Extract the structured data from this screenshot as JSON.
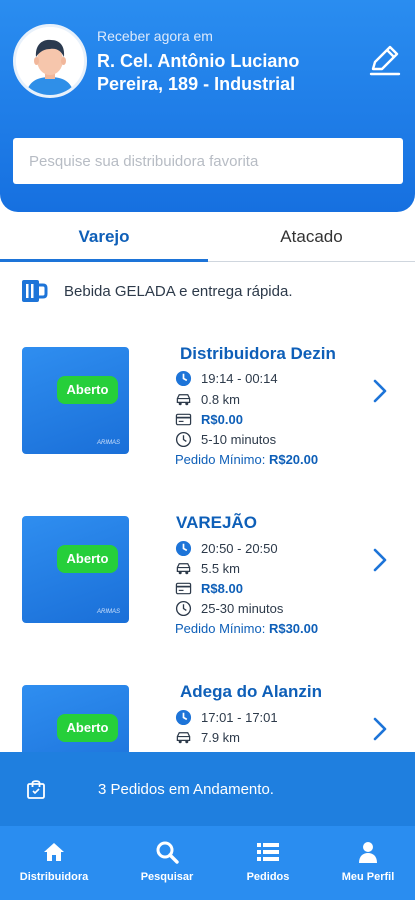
{
  "header": {
    "caption": "Receber agora em",
    "address_line1": "R. Cel. Antônio Luciano",
    "address_line2": "Pereira, 189 - Industrial",
    "search_placeholder": "Pesquise sua distribuidora favorita"
  },
  "tabs": [
    {
      "label": "Varejo",
      "active": true
    },
    {
      "label": "Atacado",
      "active": false
    }
  ],
  "banner": {
    "text": "Bebida GELADA e entrega rápida."
  },
  "stores": [
    {
      "name": "Distribuidora Dezin",
      "status": "Aberto",
      "hours": "19:14 - 00:14",
      "distance": "0.8 km",
      "fee": "R$0.00",
      "time": "5-10 minutos",
      "min_label": "Pedido Mínimo:",
      "min_value": "R$20.00"
    },
    {
      "name": "VAREJÃO",
      "status": "Aberto",
      "hours": "20:50 - 20:50",
      "distance": "5.5 km",
      "fee": "R$8.00",
      "time": "25-30 minutos",
      "min_label": "Pedido Mínimo:",
      "min_value": "R$30.00"
    },
    {
      "name": "Adega do Alanzin",
      "status": "Aberto",
      "hours": "17:01 - 17:01",
      "distance": "7.9 km"
    }
  ],
  "orders_bar": {
    "text": "3 Pedidos em Andamento."
  },
  "nav": [
    {
      "label": "Distribuidora",
      "icon": "home-icon"
    },
    {
      "label": "Pesquisar",
      "icon": "search-icon"
    },
    {
      "label": "Pedidos",
      "icon": "list-icon"
    },
    {
      "label": "Meu Perfil",
      "icon": "user-icon"
    }
  ],
  "colors": {
    "primary": "#1d74d8",
    "open_badge": "#26cf3a",
    "text_blue": "#0e5fb8"
  }
}
